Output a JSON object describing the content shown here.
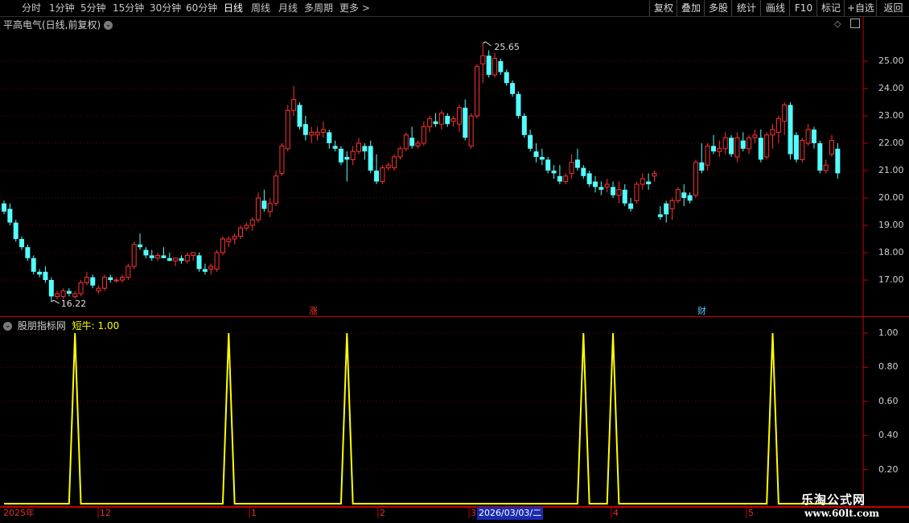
{
  "toolbar": {
    "timeframes": [
      "分时",
      "1分钟",
      "5分钟",
      "15分钟",
      "30分钟",
      "60分钟",
      "日线",
      "周线",
      "月线",
      "多周期",
      "更多 >"
    ],
    "active_timeframe": "日线",
    "right_buttons": [
      "复权",
      "叠加",
      "多股",
      "统计",
      "画线",
      "F10",
      "标记",
      "+自选",
      "返回"
    ]
  },
  "kline_panel": {
    "title": "平高电气(日线,前复权)",
    "max_label": "25.65",
    "min_label": "16.22",
    "markers": [
      "涨",
      "财"
    ],
    "y_axis_labels": [
      "25.00",
      "24.00",
      "23.00",
      "22.00",
      "21.00",
      "20.00",
      "19.00",
      "18.00",
      "17.00"
    ]
  },
  "indicator_panel": {
    "title": "股朋指标网",
    "series_label": "短牛: 1.00",
    "y_axis_labels": [
      "1.00",
      "0.80",
      "0.60",
      "0.40",
      "0.20"
    ]
  },
  "x_axis": {
    "labels": [
      "2025年",
      "12",
      "1",
      "2",
      "3",
      "2026/03/03/二",
      "4",
      "5"
    ]
  },
  "watermark": {
    "line1": "乐淘公式网",
    "line2": "www.60lt.com"
  },
  "colors": {
    "up": "#ff3232",
    "down": "#54ffff",
    "indicator": "#ffff00",
    "grid": "#6a0000",
    "frame": "#c80000"
  },
  "chart_data": [
    {
      "type": "candlestick",
      "title": "平高电气(日线,前复权)",
      "ylim": [
        16.0,
        26.0
      ],
      "annotations": {
        "max": 25.65,
        "min": 16.22
      },
      "ohlc": [
        [
          19.8,
          19.9,
          19.4,
          19.5
        ],
        [
          19.6,
          19.8,
          19.0,
          19.1
        ],
        [
          19.1,
          19.2,
          18.4,
          18.5
        ],
        [
          18.5,
          18.6,
          18.1,
          18.2
        ],
        [
          18.2,
          18.3,
          17.7,
          17.8
        ],
        [
          17.8,
          17.9,
          17.2,
          17.3
        ],
        [
          17.3,
          17.4,
          17.1,
          17.2
        ],
        [
          17.3,
          17.5,
          16.9,
          17.0
        ],
        [
          17.0,
          17.1,
          16.2,
          16.4
        ],
        [
          16.4,
          16.6,
          16.3,
          16.5
        ],
        [
          16.4,
          16.7,
          16.3,
          16.6
        ],
        [
          16.6,
          16.7,
          16.4,
          16.5
        ],
        [
          16.4,
          16.6,
          16.3,
          16.5
        ],
        [
          16.5,
          17.0,
          16.4,
          16.9
        ],
        [
          16.9,
          17.3,
          16.8,
          17.1
        ],
        [
          17.1,
          17.2,
          16.7,
          16.8
        ],
        [
          16.6,
          16.8,
          16.5,
          16.7
        ],
        [
          16.7,
          17.2,
          16.6,
          17.1
        ],
        [
          17.1,
          17.2,
          16.9,
          17.0
        ],
        [
          17.0,
          17.1,
          16.9,
          17.0
        ],
        [
          17.0,
          17.2,
          16.9,
          17.1
        ],
        [
          17.1,
          17.6,
          17.0,
          17.5
        ],
        [
          17.5,
          18.4,
          17.4,
          18.3
        ],
        [
          18.3,
          18.7,
          18.1,
          18.2
        ],
        [
          18.1,
          18.2,
          17.8,
          17.9
        ],
        [
          17.9,
          18.1,
          17.7,
          17.8
        ],
        [
          17.8,
          18.0,
          17.7,
          17.9
        ],
        [
          17.9,
          18.2,
          17.8,
          17.8
        ],
        [
          17.8,
          18.0,
          17.7,
          17.7
        ],
        [
          17.7,
          17.8,
          17.5,
          17.8
        ],
        [
          17.8,
          17.9,
          17.6,
          17.7
        ],
        [
          17.7,
          18.0,
          17.6,
          17.9
        ],
        [
          17.9,
          18.0,
          17.7,
          18.0
        ],
        [
          17.9,
          18.0,
          17.3,
          17.4
        ],
        [
          17.4,
          17.6,
          17.2,
          17.3
        ],
        [
          17.4,
          17.6,
          17.2,
          17.5
        ],
        [
          17.4,
          18.1,
          17.3,
          18.0
        ],
        [
          18.0,
          18.6,
          17.9,
          18.5
        ],
        [
          18.4,
          18.6,
          18.2,
          18.5
        ],
        [
          18.5,
          18.7,
          18.3,
          18.6
        ],
        [
          18.6,
          19.0,
          18.5,
          18.9
        ],
        [
          18.9,
          19.1,
          18.8,
          19.0
        ],
        [
          19.0,
          19.3,
          18.8,
          19.2
        ],
        [
          19.2,
          20.2,
          19.1,
          20.0
        ],
        [
          19.9,
          20.3,
          19.5,
          19.6
        ],
        [
          19.5,
          20.0,
          19.3,
          19.8
        ],
        [
          19.8,
          21.0,
          19.7,
          20.8
        ],
        [
          20.9,
          22.0,
          20.8,
          21.9
        ],
        [
          21.8,
          23.4,
          21.7,
          23.2
        ],
        [
          23.2,
          24.1,
          23.0,
          23.6
        ],
        [
          23.4,
          23.5,
          22.5,
          22.6
        ],
        [
          22.7,
          23.0,
          22.1,
          22.3
        ],
        [
          22.3,
          22.6,
          22.0,
          22.4
        ],
        [
          22.3,
          22.6,
          22.1,
          22.4
        ],
        [
          22.4,
          22.8,
          22.2,
          22.5
        ],
        [
          22.4,
          22.5,
          21.8,
          22.0
        ],
        [
          21.9,
          22.1,
          21.7,
          21.8
        ],
        [
          21.8,
          21.9,
          21.2,
          21.3
        ],
        [
          21.5,
          21.7,
          20.6,
          21.4
        ],
        [
          21.4,
          21.9,
          21.2,
          21.7
        ],
        [
          21.7,
          22.2,
          21.6,
          22.0
        ],
        [
          21.9,
          22.0,
          21.4,
          21.7
        ],
        [
          21.9,
          22.1,
          20.9,
          21.0
        ],
        [
          21.0,
          21.6,
          20.5,
          20.6
        ],
        [
          20.6,
          21.2,
          20.5,
          21.1
        ],
        [
          21.1,
          21.3,
          21.0,
          21.2
        ],
        [
          21.1,
          21.6,
          21.0,
          21.5
        ],
        [
          21.5,
          21.9,
          21.4,
          21.8
        ],
        [
          21.8,
          22.4,
          21.7,
          22.3
        ],
        [
          22.2,
          22.6,
          21.8,
          21.9
        ],
        [
          21.9,
          22.1,
          21.8,
          22.0
        ],
        [
          22.0,
          22.8,
          21.9,
          22.6
        ],
        [
          22.6,
          23.0,
          22.4,
          22.9
        ],
        [
          22.8,
          23.1,
          22.6,
          22.7
        ],
        [
          22.7,
          23.2,
          22.5,
          23.1
        ],
        [
          23.0,
          23.1,
          22.6,
          22.7
        ],
        [
          22.8,
          23.0,
          22.6,
          22.9
        ],
        [
          22.7,
          23.4,
          22.4,
          23.3
        ],
        [
          23.3,
          23.6,
          22.1,
          22.2
        ],
        [
          21.9,
          23.1,
          21.8,
          23.0
        ],
        [
          23.0,
          24.9,
          22.9,
          24.8
        ],
        [
          24.9,
          25.65,
          24.2,
          25.2
        ],
        [
          25.2,
          25.4,
          24.4,
          24.5
        ],
        [
          24.5,
          25.3,
          24.4,
          25.1
        ],
        [
          25.0,
          25.1,
          24.5,
          24.6
        ],
        [
          24.6,
          24.7,
          24.1,
          24.2
        ],
        [
          24.2,
          24.3,
          23.7,
          23.8
        ],
        [
          23.8,
          23.9,
          22.9,
          23.0
        ],
        [
          23.0,
          23.1,
          22.2,
          22.3
        ],
        [
          22.3,
          22.5,
          21.7,
          21.8
        ],
        [
          21.7,
          22.0,
          21.3,
          21.5
        ],
        [
          21.5,
          21.8,
          21.2,
          21.4
        ],
        [
          21.4,
          21.5,
          20.9,
          21.0
        ],
        [
          21.0,
          21.2,
          20.7,
          20.9
        ],
        [
          20.8,
          21.2,
          20.5,
          20.6
        ],
        [
          20.6,
          20.9,
          20.5,
          20.8
        ],
        [
          20.9,
          21.6,
          20.7,
          21.3
        ],
        [
          21.4,
          21.8,
          21.0,
          21.1
        ],
        [
          21.1,
          21.2,
          20.7,
          20.8
        ],
        [
          20.9,
          21.0,
          20.4,
          20.5
        ],
        [
          20.6,
          20.8,
          20.2,
          20.4
        ],
        [
          20.4,
          20.6,
          20.1,
          20.3
        ],
        [
          20.4,
          20.7,
          20.2,
          20.5
        ],
        [
          20.4,
          20.6,
          20.0,
          20.1
        ],
        [
          20.1,
          20.6,
          19.8,
          20.3
        ],
        [
          20.3,
          20.5,
          19.7,
          19.8
        ],
        [
          19.8,
          20.0,
          19.5,
          19.6
        ],
        [
          19.9,
          20.6,
          19.8,
          20.5
        ],
        [
          20.5,
          20.9,
          20.3,
          20.7
        ],
        [
          20.6,
          20.9,
          20.3,
          20.5
        ],
        [
          20.8,
          21.0,
          20.6,
          20.9
        ],
        [
          19.4,
          19.7,
          19.2,
          19.3
        ],
        [
          19.8,
          19.9,
          19.1,
          19.4
        ],
        [
          19.6,
          20.0,
          19.2,
          19.9
        ],
        [
          19.9,
          20.4,
          19.8,
          20.3
        ],
        [
          20.2,
          20.5,
          19.7,
          20.0
        ],
        [
          20.1,
          20.2,
          19.8,
          19.9
        ],
        [
          20.1,
          21.4,
          20.0,
          21.3
        ],
        [
          21.3,
          22.0,
          20.9,
          21.0
        ],
        [
          21.2,
          22.0,
          21.0,
          21.9
        ],
        [
          21.9,
          22.3,
          21.6,
          21.7
        ],
        [
          21.7,
          22.1,
          21.5,
          21.8
        ],
        [
          21.8,
          22.4,
          21.6,
          22.2
        ],
        [
          22.2,
          22.3,
          21.5,
          21.6
        ],
        [
          21.5,
          22.4,
          21.3,
          22.2
        ],
        [
          22.1,
          22.4,
          21.7,
          21.8
        ],
        [
          21.8,
          22.3,
          21.6,
          22.2
        ],
        [
          22.2,
          22.5,
          22.0,
          22.3
        ],
        [
          22.2,
          22.5,
          21.3,
          21.4
        ],
        [
          21.5,
          22.4,
          21.4,
          22.3
        ],
        [
          22.3,
          22.7,
          21.8,
          22.5
        ],
        [
          22.4,
          23.0,
          22.0,
          22.9
        ],
        [
          22.8,
          23.5,
          22.3,
          23.4
        ],
        [
          23.4,
          23.5,
          21.4,
          21.6
        ],
        [
          22.3,
          22.4,
          21.3,
          21.4
        ],
        [
          21.4,
          22.2,
          21.3,
          22.1
        ],
        [
          22.0,
          22.7,
          21.9,
          22.5
        ],
        [
          22.5,
          22.6,
          21.8,
          22.0
        ],
        [
          22.0,
          22.1,
          20.9,
          21.0
        ],
        [
          21.0,
          21.4,
          20.9,
          21.2
        ],
        [
          21.6,
          22.3,
          21.5,
          22.1
        ],
        [
          21.8,
          22.0,
          20.7,
          20.9
        ]
      ]
    },
    {
      "type": "line",
      "title": "短牛",
      "ylim": [
        0,
        1.05
      ],
      "spike_bars": [
        12,
        38,
        58,
        98,
        103,
        130
      ],
      "series": [
        {
          "name": "短牛",
          "spike_value": 1.0,
          "base_value": 0.0
        }
      ]
    }
  ]
}
